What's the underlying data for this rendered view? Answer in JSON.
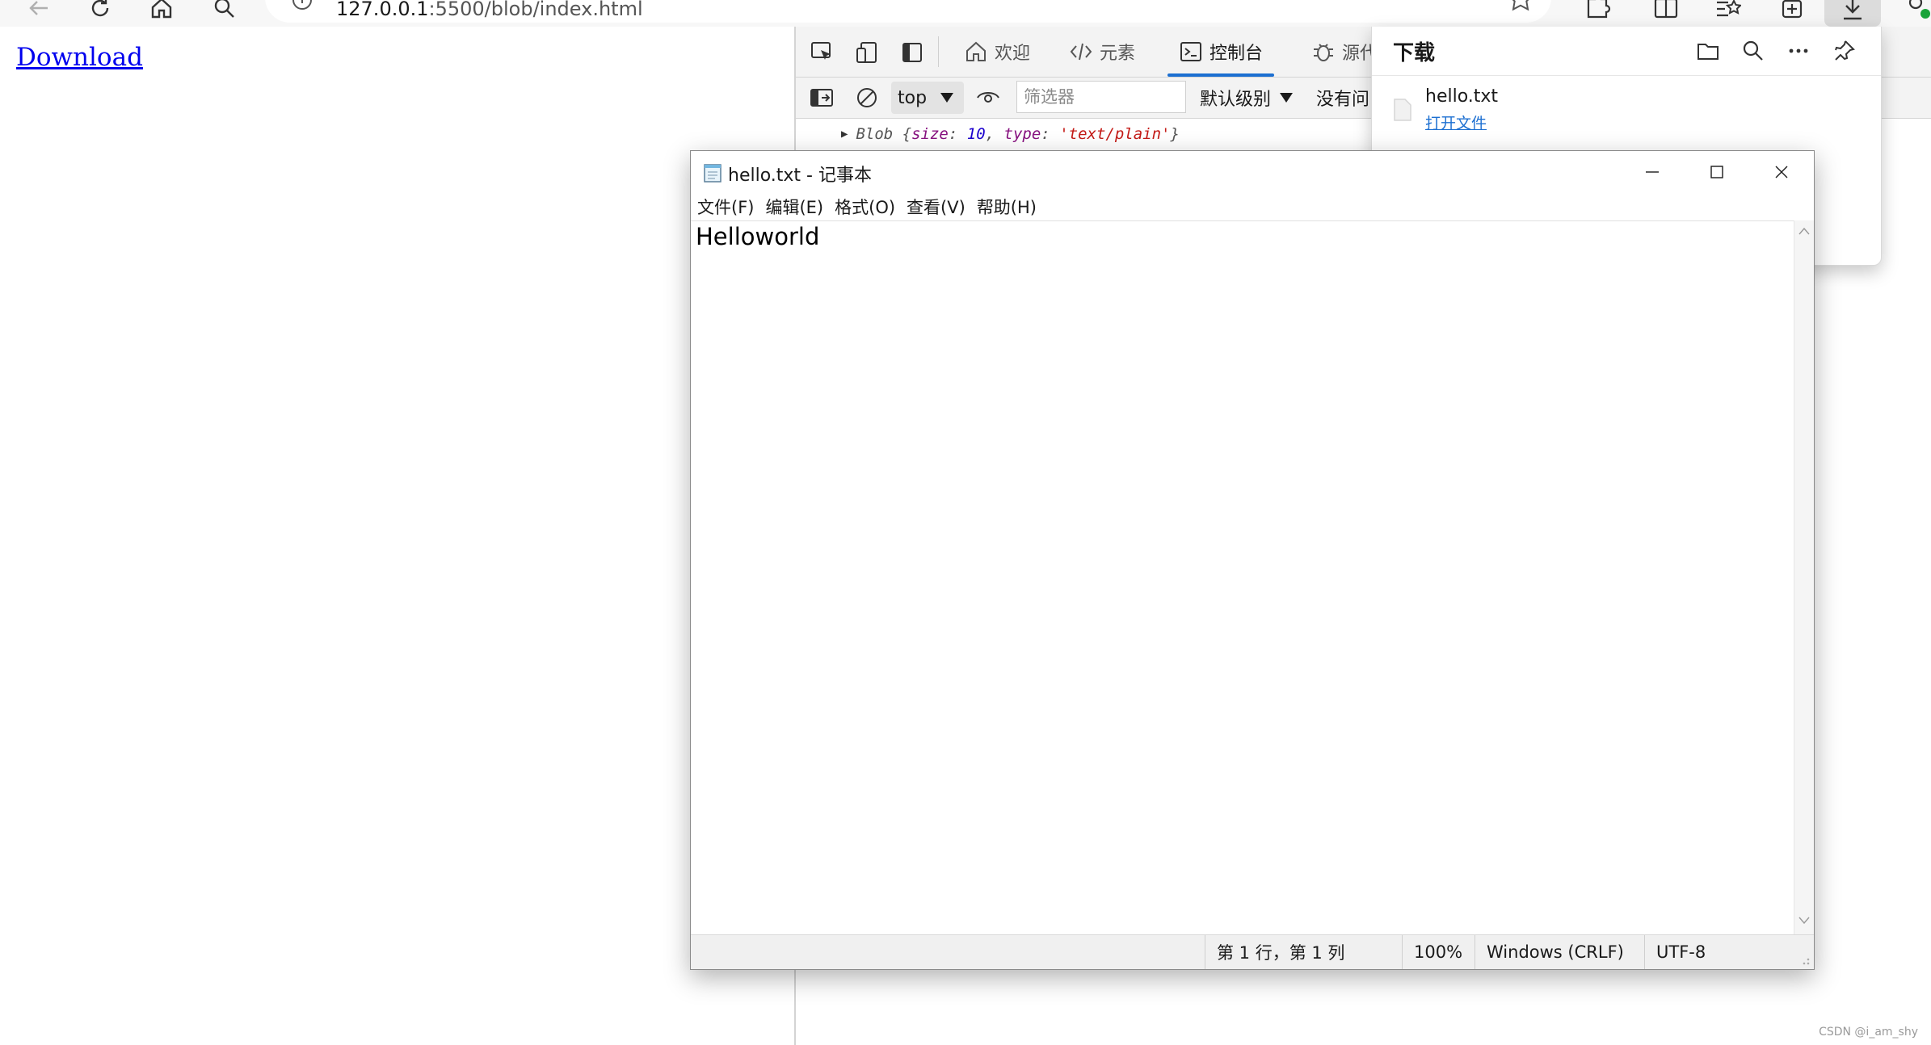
{
  "browser": {
    "url_host": "127.0.0.1",
    "url_rest": ":5500/blob/index.html"
  },
  "page": {
    "link_label": "Download"
  },
  "devtools": {
    "tabs": [
      {
        "label": "欢迎"
      },
      {
        "label": "元素"
      },
      {
        "label": "控制台"
      },
      {
        "label": "源代"
      }
    ],
    "context_label": "top",
    "filter_placeholder": "筛选器",
    "level_label": "默认级别",
    "issues_label": "没有问",
    "console": {
      "object_name": "Blob",
      "key1": "size",
      "val1": "10",
      "key2": "type",
      "val2": "'text/plain'"
    }
  },
  "downloads": {
    "title": "下载",
    "item_name": "hello.txt",
    "item_action": "打开文件"
  },
  "notepad": {
    "title": "hello.txt - 记事本",
    "menu": [
      "文件(F)",
      "编辑(E)",
      "格式(O)",
      "查看(V)",
      "帮助(H)"
    ],
    "content": "Helloworld",
    "status": {
      "position": "第 1 行，第 1 列",
      "zoom": "100%",
      "line_ending": "Windows (CRLF)",
      "encoding": "UTF-8"
    }
  },
  "watermark": "CSDN @i_am_shy"
}
